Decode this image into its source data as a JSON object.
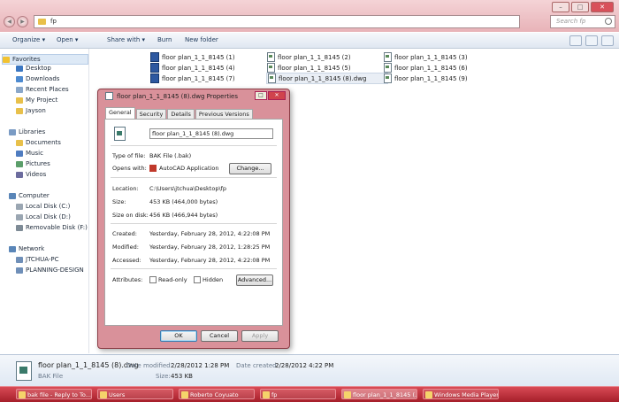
{
  "address": {
    "crumb": "fp",
    "search_placeholder": "Search fp"
  },
  "toolbar": {
    "organize": "Organize ▾",
    "open": "Open ▾",
    "share": "Share with ▾",
    "burn": "Burn",
    "new_folder": "New folder"
  },
  "navpane": {
    "favorites_header": "Favorites",
    "favorites": [
      "Desktop",
      "Downloads",
      "Recent Places",
      "My Project",
      "Jayson"
    ],
    "libraries_header": "Libraries",
    "libraries": [
      "Documents",
      "Music",
      "Pictures",
      "Videos"
    ],
    "computer_header": "Computer",
    "computer": [
      "Local Disk (C:)",
      "Local Disk (D:)",
      "Removable Disk (F:)"
    ],
    "network_header": "Network",
    "network": [
      "JTCHUA-PC",
      "PLANNING-DESIGN"
    ]
  },
  "files": [
    {
      "name": "floor plan_1_1_8145 (1)",
      "type": "dwg"
    },
    {
      "name": "floor plan_1_1_8145 (2)",
      "type": "bak"
    },
    {
      "name": "floor plan_1_1_8145 (3)",
      "type": "bak"
    },
    {
      "name": "floor plan_1_1_8145 (4)",
      "type": "dwg"
    },
    {
      "name": "floor plan_1_1_8145 (5)",
      "type": "bak"
    },
    {
      "name": "floor plan_1_1_8145 (6)",
      "type": "bak"
    },
    {
      "name": "floor plan_1_1_8145 (7)",
      "type": "dwg"
    },
    {
      "name": "floor plan_1_1_8145 (8).dwg",
      "type": "bak"
    },
    {
      "name": "floor plan_1_1_8145 (9)",
      "type": "bak"
    }
  ],
  "details": {
    "name": "floor plan_1_1_8145 (8).dwg",
    "modified_label": "Date modified:",
    "modified": "2/28/2012 1:28 PM",
    "created_label": "Date created:",
    "created": "2/28/2012 4:22 PM",
    "type": "BAK File",
    "size_label": "Size:",
    "size": "453 KB"
  },
  "dialog": {
    "title": "floor plan_1_1_8145 (8).dwg Properties",
    "tabs": [
      "General",
      "Security",
      "Details",
      "Previous Versions"
    ],
    "filename": "floor plan_1_1_8145 (8).dwg",
    "type_label": "Type of file:",
    "type_value": "BAK File (.bak)",
    "opens_label": "Opens with:",
    "opens_value": "AutoCAD Application",
    "change_button": "Change...",
    "location_label": "Location:",
    "location_value": "C:\\Users\\jtchua\\Desktop\\fp",
    "size_label": "Size:",
    "size_value": "453 KB (464,000 bytes)",
    "disk_label": "Size on disk:",
    "disk_value": "456 KB (466,944 bytes)",
    "created_label": "Created:",
    "created_value": "Yesterday, February 28, 2012, 4:22:08 PM",
    "modified_label": "Modified:",
    "modified_value": "Yesterday, February 28, 2012, 1:28:25 PM",
    "accessed_label": "Accessed:",
    "accessed_value": "Yesterday, February 28, 2012, 4:22:08 PM",
    "attributes_label": "Attributes:",
    "readonly_label": "Read-only",
    "hidden_label": "Hidden",
    "advanced_button": "Advanced...",
    "ok_button": "OK",
    "cancel_button": "Cancel",
    "apply_button": "Apply"
  },
  "taskbar": [
    {
      "label": "bak file - Reply to To...",
      "active": false
    },
    {
      "label": "Users",
      "active": false
    },
    {
      "label": "Roberto Coyuato",
      "active": false
    },
    {
      "label": "fp",
      "active": false
    },
    {
      "label": "floor plan_1_1_8145 (...",
      "active": true
    },
    {
      "label": "Windows Media Player",
      "active": false
    }
  ],
  "colors": {
    "accent": "#c4313a",
    "taskbar": "#b5252f"
  }
}
